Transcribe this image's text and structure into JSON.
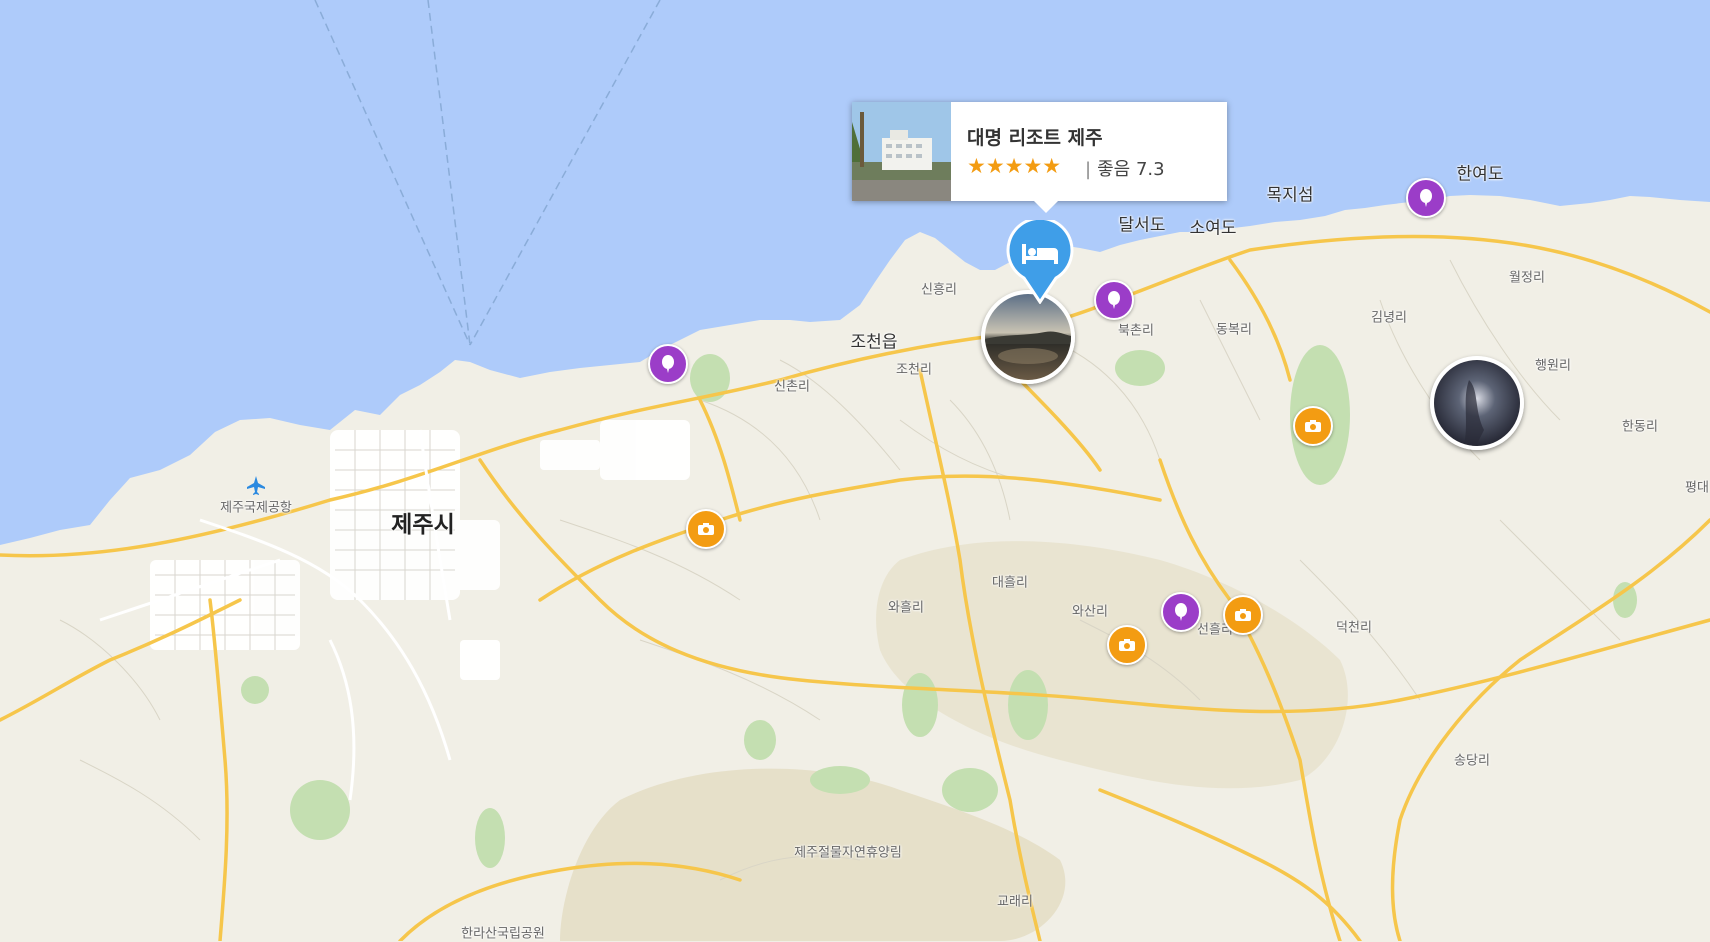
{
  "colors": {
    "sea": "#aecbfa",
    "land": "#f1efe6",
    "road": "#f6c64b",
    "park": "#c4dfb1",
    "forest": "#e1d7bb",
    "poi": "#9b3dc8",
    "camera": "#f39c12",
    "pin": "#3f9ee8"
  },
  "labels": {
    "jeju_si": "제주시",
    "airport": "제주국제공항",
    "jocheon_eup": "조천읍",
    "sinheung_ri": "신흥리",
    "jocheon_ri": "조천리",
    "sinchon_ri": "신촌리",
    "bukchon_ri": "북촌리",
    "dongbok_ri": "동복리",
    "gimnyeong_ri": "김녕리",
    "woljeong_ri": "월정리",
    "haengwon_ri": "행원리",
    "handong_ri": "한동리",
    "pyeongdae": "평대",
    "daeheul_ri": "대흘리",
    "wahheul_ri": "와흘리",
    "wasan_ri": "와산리",
    "seonheul_ri": "선흘리",
    "deokcheon_ri": "덕천리",
    "songdang_ri": "송당리",
    "gyorae_ri": "교래리",
    "jeoljimul": "제주절물자연휴양림",
    "hallasan": "한라산국립공원",
    "dalseo_do": "달서도",
    "soyeo_do": "소여도",
    "mokji_seom": "목지섬",
    "hanyeo_do": "한여도"
  },
  "popup": {
    "name": "대명 리조트 제주",
    "stars": "★★★★★",
    "separator": "|",
    "rating_label": "좋음",
    "rating_value": "7.3"
  },
  "markers": {
    "poi_icon": "balloon-icon",
    "camera_icon": "camera-icon",
    "pin_icon": "bed-icon"
  }
}
